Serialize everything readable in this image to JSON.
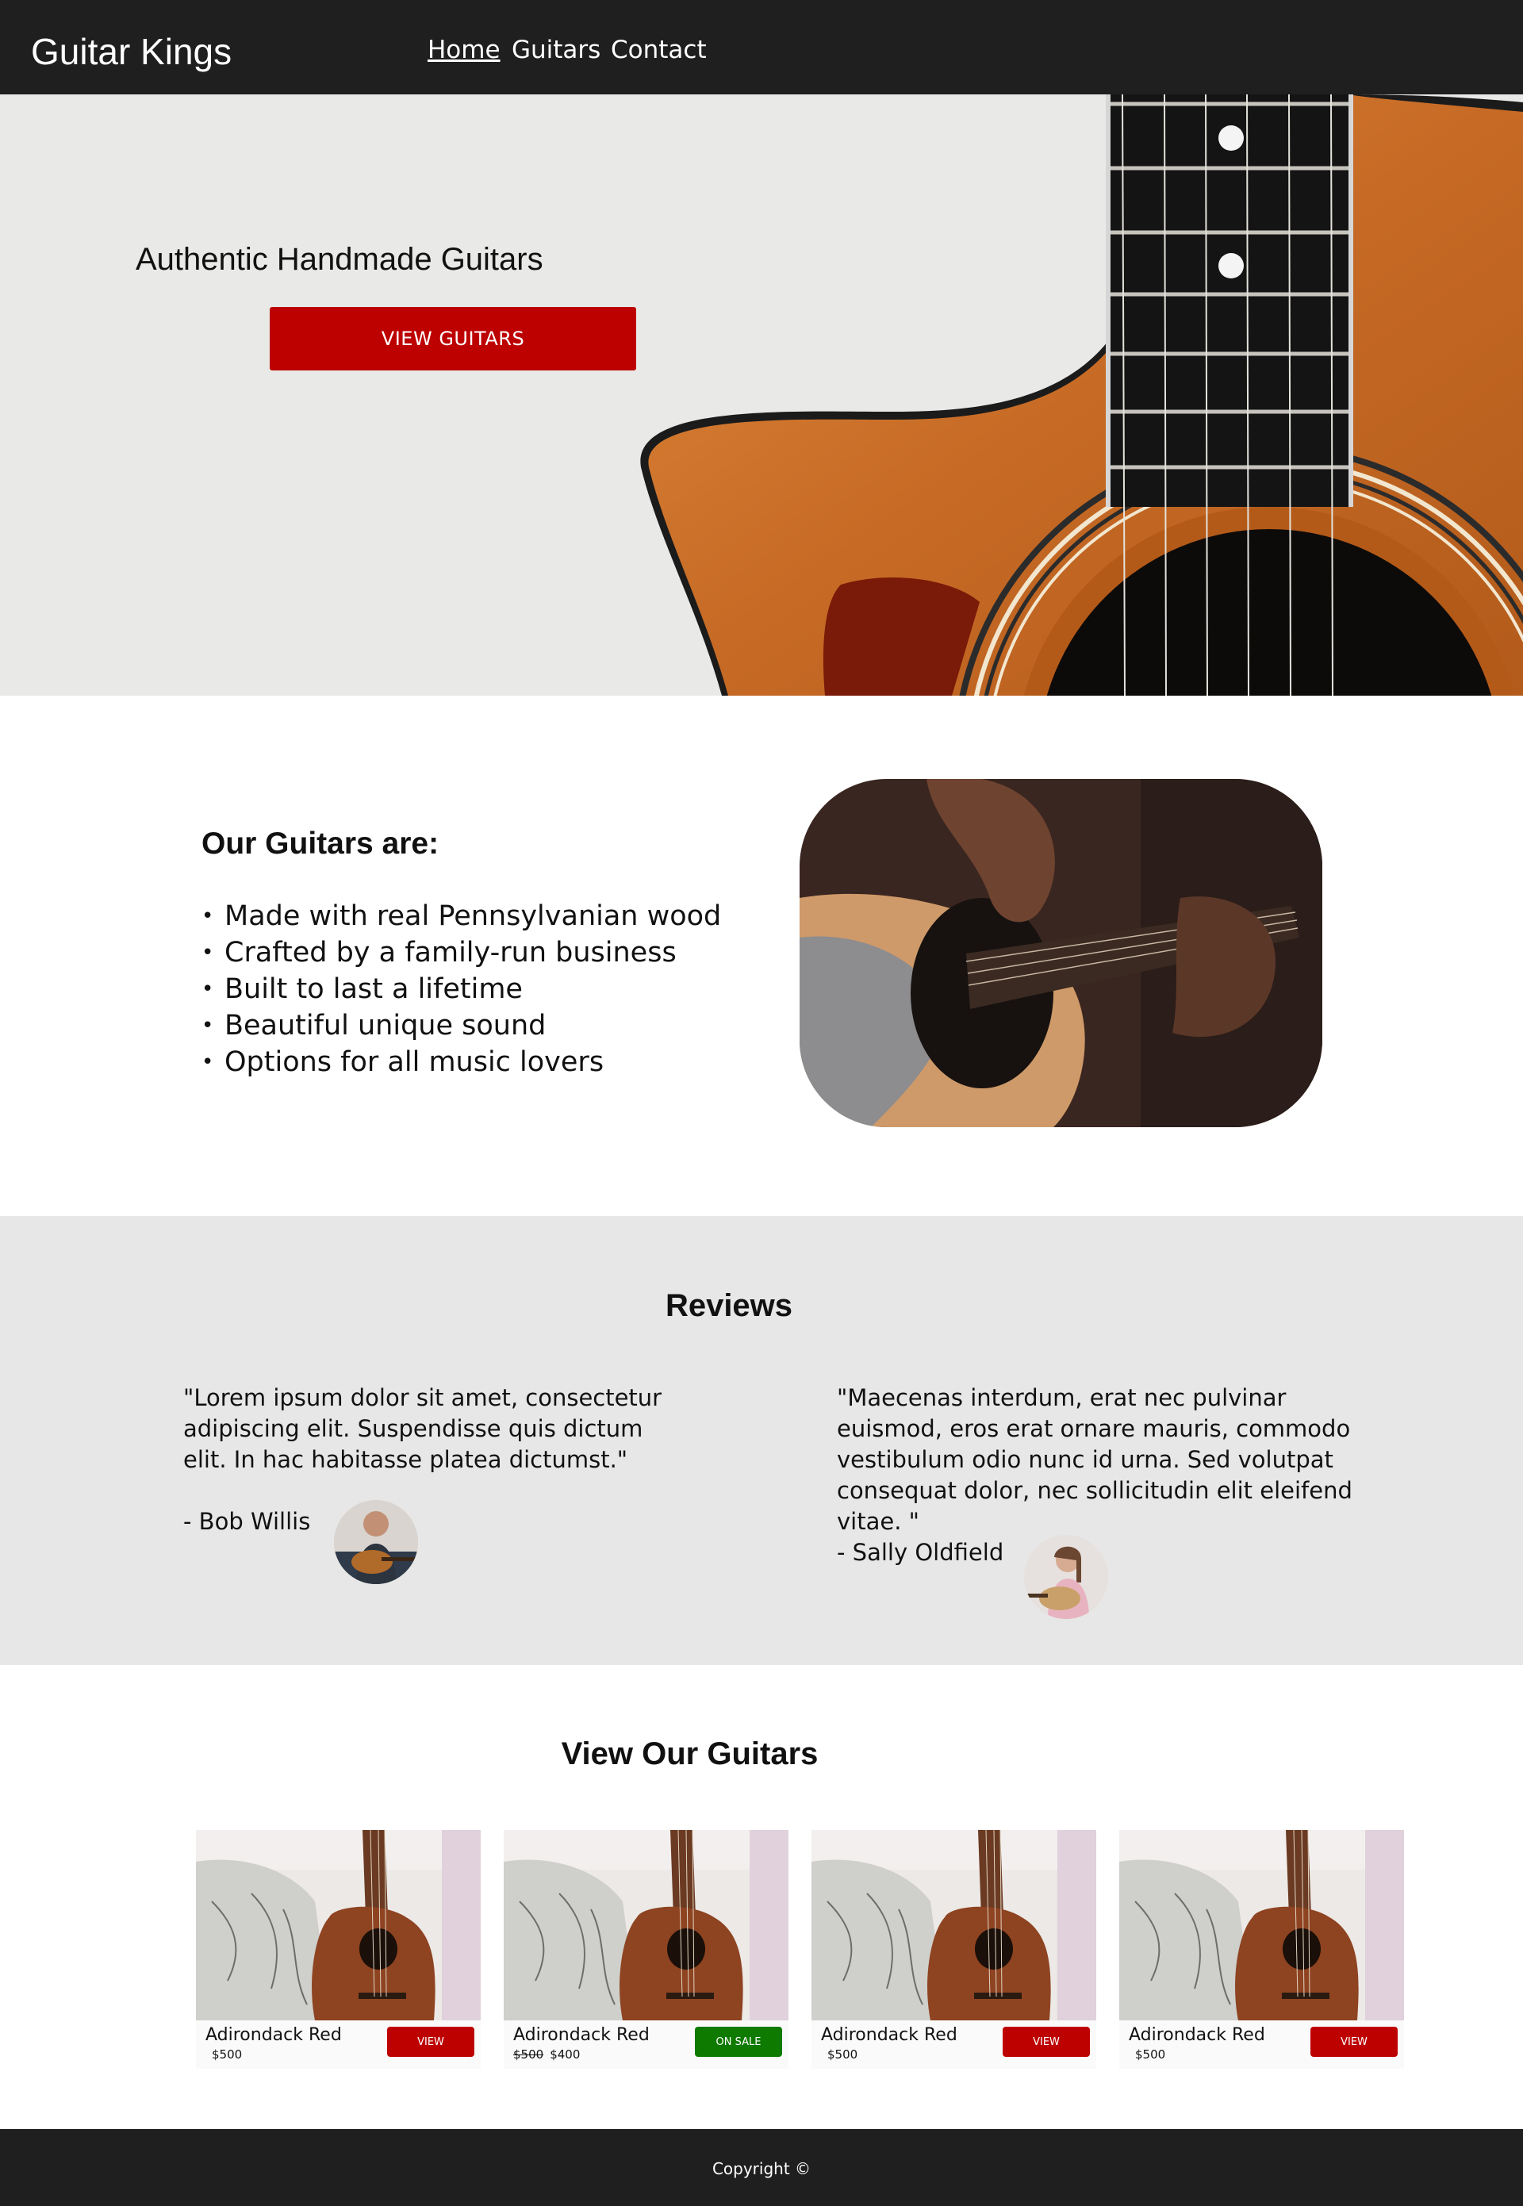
{
  "navbar": {
    "brand": "Guitar Kings",
    "links": [
      {
        "label": "Home",
        "active": true
      },
      {
        "label": "Guitars",
        "active": false
      },
      {
        "label": "Contact",
        "active": false
      }
    ]
  },
  "hero": {
    "title": "Authentic Handmade Guitars",
    "button_label": "VIEW GUITARS"
  },
  "features": {
    "title": "Our Guitars are:",
    "items": [
      "Made with real Pennsylvanian wood",
      "Crafted by a family-run business",
      "Built to last a lifetime",
      "Beautiful unique sound",
      "Options for all music lovers"
    ]
  },
  "reviews": {
    "title": "Reviews",
    "items": [
      {
        "text": "\"Lorem ipsum dolor sit amet, consectetur adipiscing elit. Suspendisse quis dictum elit. In hac habitasse platea dictumst.\"",
        "author": "- Bob Willis"
      },
      {
        "text": "\"Maecenas interdum, erat nec pulvinar euismod, eros erat ornare mauris, commodo vestibulum odio nunc id urna. Sed volutpat consequat dolor, nec sollicitudin elit eleifend vitae. \"",
        "author": "- Sally Oldfield"
      }
    ]
  },
  "products": {
    "title": "View Our Guitars",
    "cards": [
      {
        "name": "Adirondack Red",
        "price": "$500",
        "old_price": "",
        "button": "VIEW",
        "button_color": "#bd0000"
      },
      {
        "name": "Adirondack Red",
        "price": "$400",
        "old_price": "$500",
        "button": "ON SALE",
        "button_color": "#0f7a00"
      },
      {
        "name": "Adirondack Red",
        "price": "$500",
        "old_price": "",
        "button": "VIEW",
        "button_color": "#bd0000"
      },
      {
        "name": "Adirondack Red",
        "price": "$500",
        "old_price": "",
        "button": "VIEW",
        "button_color": "#bd0000"
      }
    ]
  },
  "footer": {
    "text": "Copyright ©"
  },
  "colors": {
    "nav_bg": "#1f1f1f",
    "accent_red": "#bd0000",
    "sale_green": "#0f7a00",
    "reviews_bg": "#e7e7e7"
  }
}
